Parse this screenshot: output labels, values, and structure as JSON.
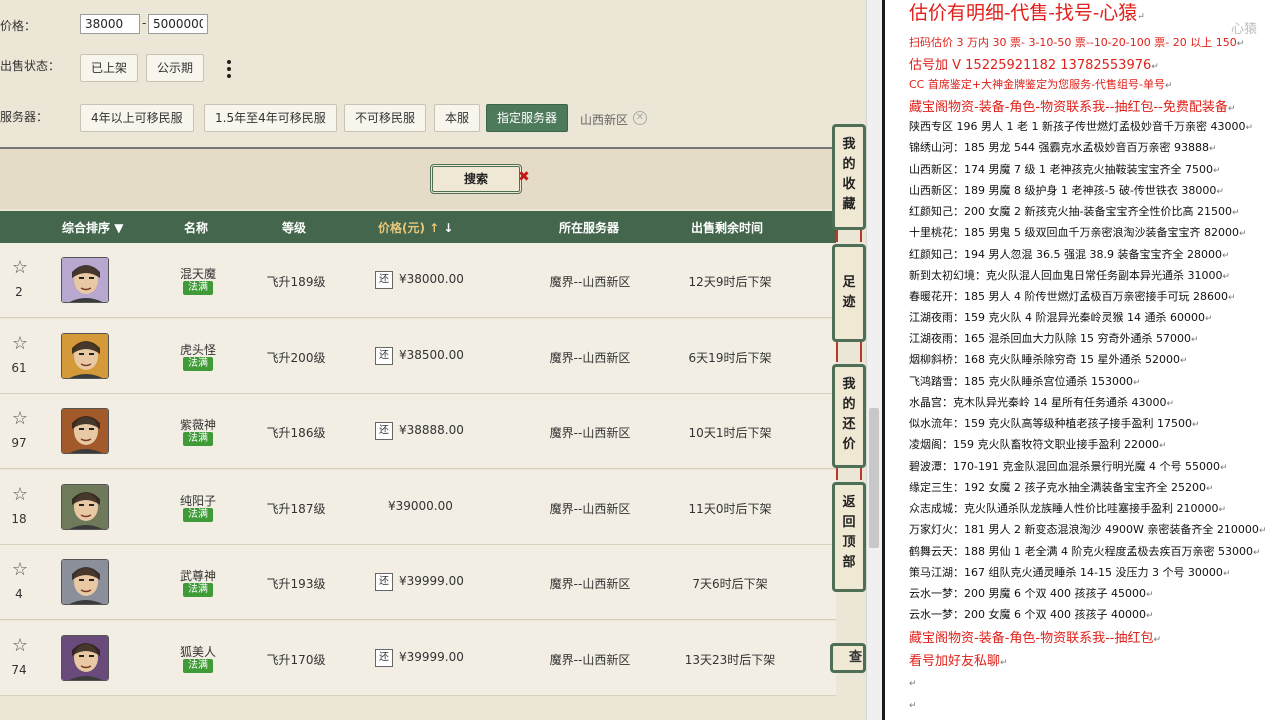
{
  "filters": {
    "price_label": "价格：",
    "price_min": "38000",
    "price_max": "5000000",
    "price_separator": "-",
    "status_label": "出售状态：",
    "status_options": [
      "已上架",
      "公示期"
    ],
    "server_label": "服务器：",
    "server_options": [
      "4年以上可移民服",
      "1.5年至4年可移民服",
      "不可移民服",
      "本服",
      "指定服务器"
    ],
    "selected_server_tag": "山西新区"
  },
  "search": {
    "label": "搜索",
    "clear": "✖"
  },
  "table": {
    "headers": {
      "sort": "综合排序",
      "name": "名称",
      "level": "等级",
      "price": "价格(元)",
      "server": "所在服务器",
      "remain": "出售剩余时间"
    },
    "rows": [
      {
        "fav": "2",
        "name": "混天魔",
        "badge": "法满",
        "level": "飞升189级",
        "huan": "还",
        "price": "¥38000.00",
        "server": "魔界--山西新区",
        "remain": "12天9时后下架",
        "avatar_color": "#b8a7cf"
      },
      {
        "fav": "61",
        "name": "虎头怪",
        "badge": "法满",
        "level": "飞升200级",
        "huan": "还",
        "price": "¥38500.00",
        "server": "魔界--山西新区",
        "remain": "6天19时后下架",
        "avatar_color": "#d49a3a"
      },
      {
        "fav": "97",
        "name": "紫薇神",
        "badge": "法满",
        "level": "飞升186级",
        "huan": "还",
        "price": "¥38888.00",
        "server": "魔界--山西新区",
        "remain": "10天1时后下架",
        "avatar_color": "#a25a2a"
      },
      {
        "fav": "18",
        "name": "纯阳子",
        "badge": "法满",
        "level": "飞升187级",
        "huan": "",
        "price": "¥39000.00",
        "server": "魔界--山西新区",
        "remain": "11天0时后下架",
        "avatar_color": "#6e7a5a"
      },
      {
        "fav": "4",
        "name": "武尊神",
        "badge": "法满",
        "level": "飞升193级",
        "huan": "还",
        "price": "¥39999.00",
        "server": "魔界--山西新区",
        "remain": "7天6时后下架",
        "avatar_color": "#8a8f9a"
      },
      {
        "fav": "74",
        "name": "狐美人",
        "badge": "法满",
        "level": "飞升170级",
        "huan": "还",
        "price": "¥39999.00",
        "server": "魔界--山西新区",
        "remain": "13天23时后下架",
        "avatar_color": "#6a4a7a"
      }
    ]
  },
  "side_tabs": {
    "favorites": [
      "我",
      "的",
      "收",
      "藏"
    ],
    "footprint": [
      "足",
      "迹"
    ],
    "bargain": [
      "我",
      "的",
      "还",
      "价"
    ],
    "back_top": [
      "返",
      "回",
      "顶",
      "部"
    ],
    "query": "查"
  },
  "notes": {
    "watermark": "心猿",
    "title": "估价有明细-代售-找号-心猿",
    "lines": [
      {
        "text": "扫码估价 3 万内 30 票- 3-10-50 票--10-20-100 票- 20 以上 150",
        "red": true
      },
      {
        "text": "估号加 V 15225921182    13782553976",
        "red": true,
        "big": true
      },
      {
        "text": "CC 首席鉴定+大神金牌鉴定为您服务-代售组号-单号",
        "red": true
      },
      {
        "text": "藏宝阁物资-装备-角色-物资联系我--抽红包--免费配装备",
        "red": true,
        "big": true
      },
      {
        "text": "陕西专区 196 男人 1 老 1 新孩子传世燃灯孟极妙音千万亲密 43000",
        "red": false
      },
      {
        "text": "锦绣山河：185 男龙 544 强霸克水孟极妙音百万亲密 93888",
        "red": false
      },
      {
        "text": "山西新区：174 男魔 7 级 1 老神孩克火抽鞍装宝宝齐全 7500",
        "red": false
      },
      {
        "text": "山西新区：189 男魔 8 级护身 1 老神孩-5 破-传世铁衣 38000",
        "red": false
      },
      {
        "text": "红颜知己：200 女魔 2 新孩克火抽-装备宝宝齐全性价比高 21500",
        "red": false
      },
      {
        "text": "十里桃花：185 男鬼 5 级双回血千万亲密浪淘沙装备宝宝齐 82000",
        "red": false
      },
      {
        "text": "红颜知己：194 男人忽混 36.5 强混 38.9 装备宝宝齐全 28000",
        "red": false
      },
      {
        "text": "新到太初幻境：克火队混人回血鬼日常任务副本异光通杀 31000",
        "red": false
      },
      {
        "text": "春暖花开：185 男人 4 阶传世燃灯孟极百万亲密接手可玩 28600",
        "red": false
      },
      {
        "text": "江湖夜雨：159 克火队 4 阶混异光秦岭灵猴 14 通杀 60000",
        "red": false
      },
      {
        "text": "江湖夜雨：165 混杀回血大力队除 15 穷奇外通杀 57000",
        "red": false
      },
      {
        "text": "烟柳斜桥：168 克火队睡杀除穷奇 15 星外通杀 52000",
        "red": false
      },
      {
        "text": "飞鸿踏雪：185 克火队睡杀宫位通杀 153000",
        "red": false
      },
      {
        "text": "水晶宫：克木队异光秦岭 14 星所有任务通杀 43000",
        "red": false
      },
      {
        "text": "似水流年：159 克火队高等级种植老孩子接手盈利 17500",
        "red": false
      },
      {
        "text": "凌烟阁：159 克火队畜牧符文职业接手盈利 22000",
        "red": false
      },
      {
        "text": "碧波潭：170-191 克金队混回血混杀景行明光魔 4 个号 55000",
        "red": false
      },
      {
        "text": "缘定三生：192 女魔 2 孩子克水抽全满装备宝宝齐全 25200",
        "red": false
      },
      {
        "text": "众志成城：克火队通杀队龙族睡人性价比哇塞接手盈利 210000",
        "red": false
      },
      {
        "text": "万家灯火：181 男人 2 新变态混浪淘沙 4900W 亲密装备齐全 210000",
        "red": false
      },
      {
        "text": "鹤舞云天：188 男仙 1 老全满 4 阶克火程度孟极去疾百万亲密 53000",
        "red": false
      },
      {
        "text": "策马江湖：167 组队克火通灵睡杀 14-15 没压力 3 个号 30000",
        "red": false
      },
      {
        "text": "云水一梦：200 男魔 6 个双 400 孩孩子 45000",
        "red": false
      },
      {
        "text": "云水一梦：200 女魔 6 个双 400 孩孩子 40000",
        "red": false
      },
      {
        "text": "藏宝阁物资-装备-角色-物资联系我--抽红包",
        "red": true,
        "big": true
      },
      {
        "text": "看号加好友私聊",
        "red": true,
        "big": true
      }
    ]
  },
  "colors": {
    "header_green": "#44664d",
    "active_button": "#4e7a5c",
    "badge_green": "#3f9a38",
    "note_red": "#e0201a"
  }
}
